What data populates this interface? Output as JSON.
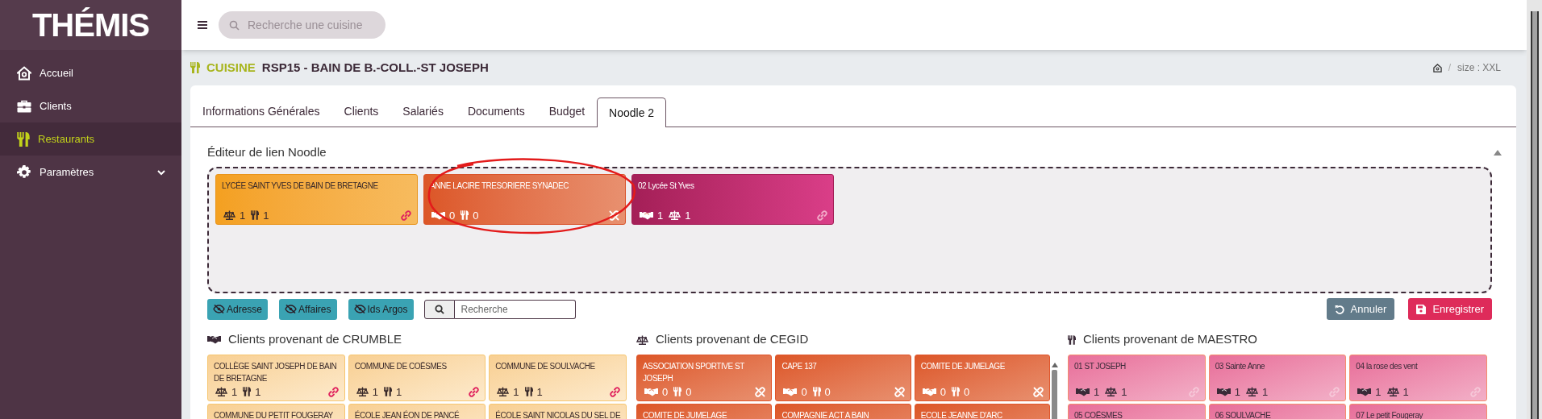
{
  "sidebar": {
    "logo": "THÉMIS",
    "items": [
      {
        "label": "Accueil",
        "kind": "home",
        "selected": false
      },
      {
        "label": "Clients",
        "kind": "briefcase",
        "selected": false
      },
      {
        "label": "Restaurants",
        "kind": "cutlery",
        "selected": true
      },
      {
        "label": "Paramètres",
        "kind": "gear",
        "selected": false,
        "expanded": false
      }
    ]
  },
  "topbar": {
    "search_placeholder": "Recherche une cuisine"
  },
  "header": {
    "category": "CUISINE",
    "title": "RSP15 - BAIN DE B.-COLL.-ST JOSEPH",
    "breadcrumb_separator": "/",
    "breadcrumb": "size : XXL"
  },
  "tabs": [
    {
      "label": "Informations Générales",
      "selected": false
    },
    {
      "label": "Clients",
      "selected": false
    },
    {
      "label": "Salariés",
      "selected": false
    },
    {
      "label": "Documents",
      "selected": false
    },
    {
      "label": "Budget",
      "selected": false
    },
    {
      "label": "Noodle 2",
      "selected": true
    }
  ],
  "editor": {
    "title": "Éditeur de lien Noodle",
    "cards": [
      {
        "kind": "crumble",
        "name": "LYCÉE SAINT YVES DE BAIN DE BRETAGNE",
        "stats": [
          {
            "kind": "scales",
            "value": "1"
          },
          {
            "kind": "cutlery",
            "value": "1"
          }
        ],
        "linked": true
      },
      {
        "kind": "cegid",
        "name": "ANNE LACIRE TRESORIERE SYNADEC",
        "stats": [
          {
            "kind": "handshake",
            "value": "0"
          },
          {
            "kind": "cutlery",
            "value": "0"
          }
        ],
        "linked": false
      },
      {
        "kind": "maestro",
        "name": "02 Lycée St Yves",
        "stats": [
          {
            "kind": "handshake",
            "value": "1"
          },
          {
            "kind": "scales",
            "value": "1"
          }
        ],
        "linked": true
      }
    ]
  },
  "toolbar": {
    "toggles": [
      {
        "label": "Adresse"
      },
      {
        "label": "Affaires"
      },
      {
        "label": "Ids Argos"
      }
    ],
    "search_placeholder": "Recherche",
    "cancel": "Annuler",
    "save": "Enregistrer"
  },
  "sources": [
    {
      "kind": "crumble",
      "title": "Clients provenant de CRUMBLE",
      "cards": [
        {
          "name": "COLLÈGE SAINT JOSEPH DE BAIN DE BRETAGNE",
          "stats": [
            {
              "kind": "scales",
              "value": "1"
            },
            {
              "kind": "cutlery",
              "value": "1"
            }
          ],
          "linked": true
        },
        {
          "name": "COMMUNE DE COËSMES",
          "stats": [
            {
              "kind": "scales",
              "value": "1"
            },
            {
              "kind": "cutlery",
              "value": "1"
            }
          ],
          "linked": true
        },
        {
          "name": "COMMUNE DE SOULVACHE",
          "stats": [
            {
              "kind": "scales",
              "value": "1"
            },
            {
              "kind": "cutlery",
              "value": "1"
            }
          ],
          "linked": true
        },
        {
          "name": "COMMUNE DU PETIT FOUGERAY"
        },
        {
          "name": "ÉCOLE JEAN ÉON DE PANCÉ"
        },
        {
          "name": "ÉCOLE SAINT NICOLAS DU SEL DE"
        }
      ]
    },
    {
      "kind": "cegid",
      "title": "Clients provenant de CEGID",
      "cards": [
        {
          "name": "ASSOCIATION SPORTIVE ST JOSEPH",
          "stats": [
            {
              "kind": "handshake",
              "value": "0"
            },
            {
              "kind": "cutlery",
              "value": "0"
            }
          ],
          "linked": false
        },
        {
          "name": "CAPE 137",
          "stats": [
            {
              "kind": "handshake",
              "value": "0"
            },
            {
              "kind": "cutlery",
              "value": "0"
            }
          ],
          "linked": false
        },
        {
          "name": "COMITE DE JUMELAGE",
          "stats": [
            {
              "kind": "handshake",
              "value": "0"
            },
            {
              "kind": "cutlery",
              "value": "0"
            }
          ],
          "linked": false
        },
        {
          "name": "COMITE DE JUMELAGE"
        },
        {
          "name": "COMPAGNIE ACT A BAIN"
        },
        {
          "name": "ECOLE JEANNE D'ARC"
        }
      ]
    },
    {
      "kind": "maestro",
      "title": "Clients provenant de MAESTRO",
      "cards": [
        {
          "name": "01 ST JOSEPH",
          "stats": [
            {
              "kind": "handshake",
              "value": "1"
            },
            {
              "kind": "scales",
              "value": "1"
            }
          ],
          "linked": true
        },
        {
          "name": "03 Sainte Anne",
          "stats": [
            {
              "kind": "handshake",
              "value": "1"
            },
            {
              "kind": "scales",
              "value": "1"
            }
          ],
          "linked": true
        },
        {
          "name": "04 la rose des vent",
          "stats": [
            {
              "kind": "handshake",
              "value": "1"
            },
            {
              "kind": "scales",
              "value": "1"
            }
          ],
          "linked": true
        },
        {
          "name": "05 COËSMES"
        },
        {
          "name": "06 SOULVACHE"
        },
        {
          "name": "07 Le petit Fougeray"
        }
      ]
    }
  ]
}
